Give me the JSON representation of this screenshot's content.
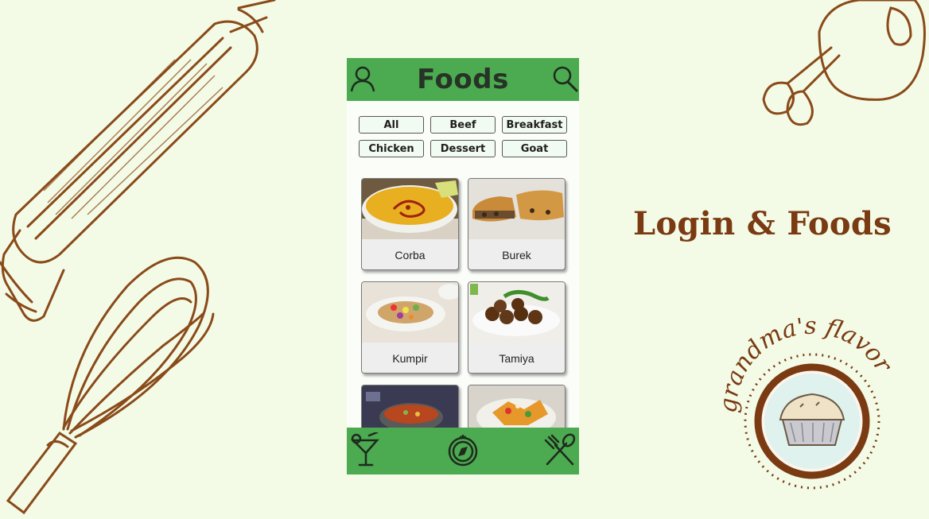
{
  "slide": {
    "title": "Login & Foods"
  },
  "app": {
    "title": "Foods",
    "filters": [
      "All",
      "Beef",
      "Breakfast",
      "Chicken",
      "Dessert",
      "Goat"
    ],
    "foods": [
      {
        "name": "Corba"
      },
      {
        "name": "Burek"
      },
      {
        "name": "Kumpir"
      },
      {
        "name": "Tamiya"
      },
      {
        "name": ""
      },
      {
        "name": ""
      }
    ],
    "bottom_nav": [
      "cocktail-icon",
      "compass-icon",
      "utensils-icon"
    ]
  },
  "logo": {
    "text": "grandma's flavor"
  },
  "colors": {
    "background": "#f3fbe6",
    "accent_green": "#4caa50",
    "brown": "#7a3a12"
  }
}
